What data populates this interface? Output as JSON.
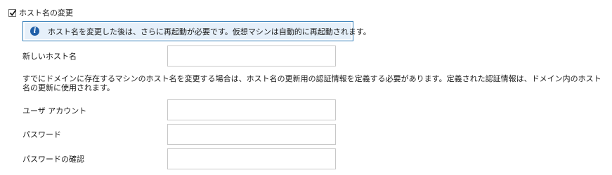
{
  "hostname_change": {
    "checkbox_label": "ホスト名の変更",
    "checked": true,
    "info_message": "ホスト名を変更した後は、さらに再起動が必要です。仮想マシンは自動的に再起動されます。",
    "info_icon": "info-icon",
    "new_hostname_label": "新しいホスト名",
    "new_hostname_value": "",
    "description": "すでにドメインに存在するマシンのホスト名を変更する場合は、ホスト名の更新用の認証情報を定義する必要があります。定義された認証情報は、ドメイン内のホスト名の更新に使用されます。",
    "user_account_label": "ユーザ アカウント",
    "user_account_value": "",
    "password_label": "パスワード",
    "password_value": "",
    "password_confirm_label": "パスワードの確認",
    "password_confirm_value": ""
  },
  "colors": {
    "info_border": "#2f7bb7",
    "info_background": "#e6f0fa",
    "info_icon": "#1f5fa8",
    "field_border": "#c8c8c8"
  }
}
